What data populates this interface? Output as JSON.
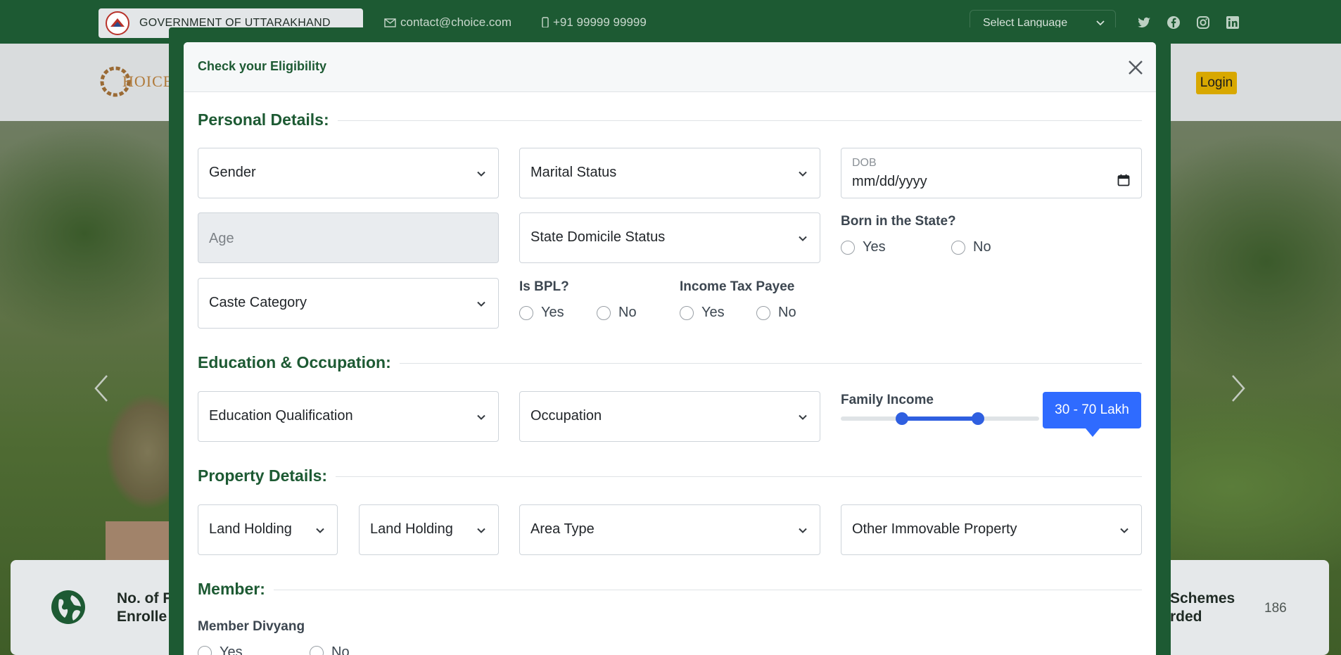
{
  "topbar": {
    "govt_name": "GOVERNMENT OF UTTARAKHAND",
    "email": "contact@choice.com",
    "phone": "+91 99999 99999",
    "language_select": "Select Language",
    "social_icons": [
      "twitter-icon",
      "facebook-icon",
      "instagram-icon",
      "linkedin-icon"
    ]
  },
  "navbar": {
    "logo_text": "HOICE",
    "login_label": "Login"
  },
  "stats": {
    "left_label_line1": "No. of F",
    "left_label_line2": "Enrolle",
    "right_label_line1": "Schemes",
    "right_label_line2": "rded",
    "right_count": "186"
  },
  "modal": {
    "title": "Check your Eligibility",
    "sections": {
      "personal": "Personal Details:",
      "education": "Education & Occupation:",
      "property": "Property Details:",
      "member": "Member:"
    },
    "personal": {
      "gender": "Gender",
      "marital_status": "Marital Status",
      "dob_label": "DOB",
      "dob_value": "mm/dd/yyyy",
      "age_placeholder": "Age",
      "domicile": "State Domicile Status",
      "born_in_state_label": "Born in the State?",
      "caste": "Caste Category",
      "is_bpl_label": "Is BPL?",
      "income_tax_label": "Income Tax Payee",
      "yes": "Yes",
      "no": "No"
    },
    "education": {
      "qualification": "Education Qualification",
      "occupation": "Occupation",
      "family_income_label": "Family Income",
      "income_range": "30 - 70 Lakh",
      "income_range_low_fraction": 0.31,
      "income_range_high_fraction": 0.69
    },
    "property": {
      "land_holding_1": "Land Holding",
      "land_holding_2": "Land Holding",
      "area_type": "Area Type",
      "other_property": "Other Immovable Property"
    },
    "member": {
      "divyang_label": "Member Divyang",
      "yes": "Yes",
      "no": "No"
    }
  },
  "colors": {
    "brand_green": "#1d5a33",
    "accent_blue": "#2f6bff",
    "login_yellow": "#d8a800"
  }
}
